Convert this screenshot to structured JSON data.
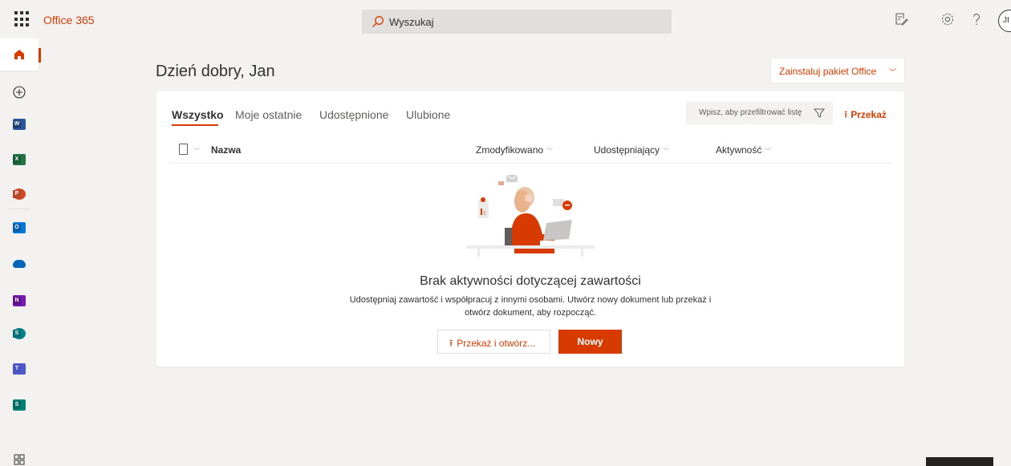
{
  "header": {
    "app_name": "Office 365",
    "search_placeholder": "Wyszukaj",
    "avatar_initials": "JI",
    "icons": [
      "waffle-icon",
      "feedback-icon",
      "settings-icon",
      "help-icon"
    ]
  },
  "rail": {
    "items": [
      {
        "name": "home",
        "icon": "home-icon"
      },
      {
        "name": "create",
        "icon": "plus-circle-icon"
      },
      {
        "name": "word",
        "icon": "word-icon",
        "letter": "W",
        "color": "#2b579a"
      },
      {
        "name": "excel",
        "icon": "excel-icon",
        "letter": "X",
        "color": "#217346"
      },
      {
        "name": "powerpoint",
        "icon": "powerpoint-icon",
        "letter": "P",
        "color": "#d24726"
      },
      {
        "name": "outlook",
        "icon": "outlook-icon",
        "letter": "O",
        "color": "#0078d4"
      },
      {
        "name": "onedrive",
        "icon": "onedrive-icon",
        "color": "#0364b8"
      },
      {
        "name": "onenote",
        "icon": "onenote-icon",
        "letter": "N",
        "color": "#7719aa"
      },
      {
        "name": "sharepoint",
        "icon": "sharepoint-icon",
        "letter": "S",
        "color": "#038387"
      },
      {
        "name": "teams",
        "icon": "teams-icon",
        "color": "#5059c9"
      },
      {
        "name": "sway",
        "icon": "sway-icon",
        "letter": "S",
        "color": "#008272"
      },
      {
        "name": "all-apps",
        "icon": "all-apps-icon"
      }
    ]
  },
  "main": {
    "greeting": "Dzień dobry, Jan",
    "install_label": "Zainstaluj pakiet Office",
    "tabs": [
      "Wszystko",
      "Moje ostatnie",
      "Udostępnione",
      "Ulubione"
    ],
    "active_tab": "Wszystko",
    "filter_placeholder": "Wpisz, aby przefiltrować listę",
    "upload_label": "Przekaż",
    "columns": {
      "name": "Nazwa",
      "modified": "Zmodyfikowano",
      "shared_by": "Udostępniający",
      "activity": "Aktywność"
    },
    "empty": {
      "title": "Brak aktywności dotyczącej zawartości",
      "subtitle": "Udostępniaj zawartość i współpracuj z innymi osobami. Utwórz nowy dokument lub przekaż i otwórz dokument, aby rozpocząć.",
      "open_label": "Przekaż i otwórz...",
      "new_label": "Nowy"
    }
  },
  "colors": {
    "accent": "#d83b01",
    "background": "#f3f2f1",
    "card": "#ffffff"
  }
}
